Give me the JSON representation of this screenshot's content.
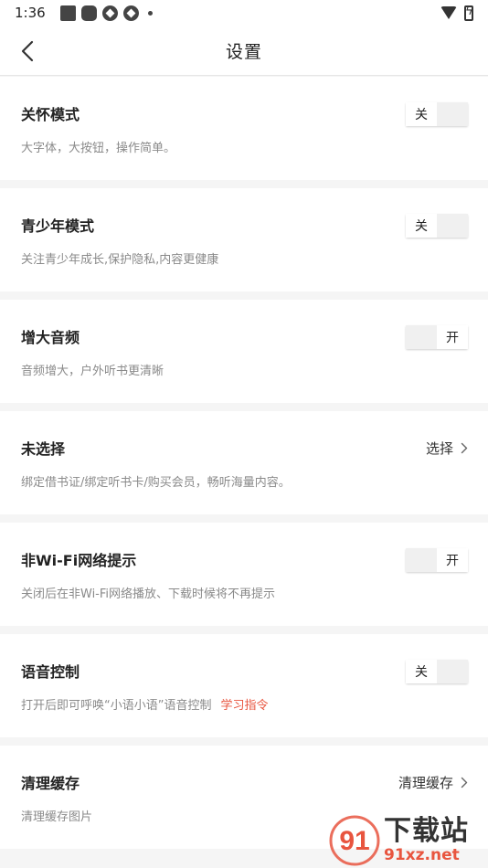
{
  "status_bar": {
    "time": "1:36"
  },
  "header": {
    "title": "设置"
  },
  "items": [
    {
      "title": "关怀模式",
      "desc": "大字体，大按钮，操作简单。",
      "toggle": {
        "on_label": "开",
        "off_label": "关",
        "state": "off"
      }
    },
    {
      "title": "青少年模式",
      "desc": "关注青少年成长,保护隐私,内容更健康",
      "toggle": {
        "on_label": "开",
        "off_label": "关",
        "state": "off"
      }
    },
    {
      "title": "增大音频",
      "desc": "音频增大，户外听书更清晰",
      "toggle": {
        "on_label": "开",
        "off_label": "关",
        "state": "on"
      }
    },
    {
      "title": "未选择",
      "desc": "绑定借书证/绑定听书卡/购买会员，畅听海量内容。",
      "action_label": "选择"
    },
    {
      "title": "非Wi-Fi网络提示",
      "desc": "关闭后在非Wi-Fi网络播放、下载时候将不再提示",
      "toggle": {
        "on_label": "开",
        "off_label": "关",
        "state": "on"
      }
    },
    {
      "title": "语音控制",
      "desc": "打开后即可呼唤“小语小语”语音控制",
      "link_label": "学习指令",
      "toggle": {
        "on_label": "开",
        "off_label": "关",
        "state": "off"
      }
    },
    {
      "title": "清理缓存",
      "desc": "清理缓存图片",
      "action_label": "清理缓存"
    }
  ],
  "watermark": {
    "main": "下载站",
    "sub": "91xz.net",
    "logo_text": "91"
  },
  "colors": {
    "accent": "#e8553f",
    "background": "#f5f5f5",
    "card": "#ffffff"
  }
}
